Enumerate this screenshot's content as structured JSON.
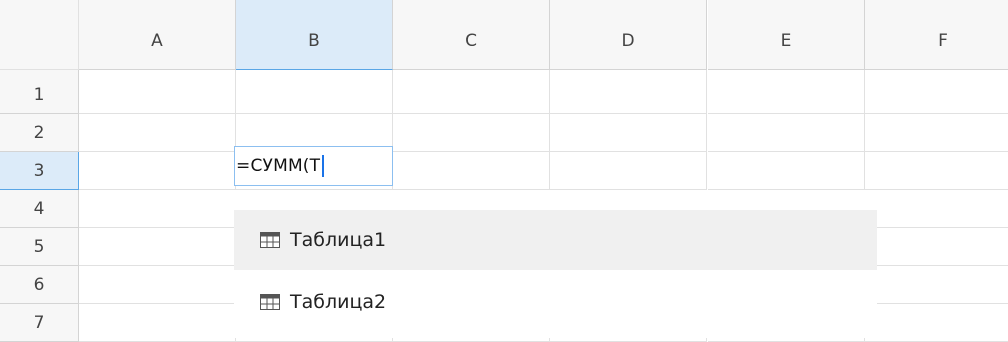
{
  "columns": [
    "A",
    "B",
    "C",
    "D",
    "E",
    "F"
  ],
  "rows": [
    "1",
    "2",
    "3",
    "4",
    "5",
    "6",
    "7"
  ],
  "selected_column": "B",
  "selected_row": "3",
  "editor": {
    "text": "=СУММ(Т"
  },
  "suggestions": [
    {
      "label": "Таблица1",
      "icon": "table-icon",
      "highlighted": true
    },
    {
      "label": "Таблица2",
      "icon": "table-icon",
      "highlighted": false
    }
  ],
  "colors": {
    "selection": "#dcebf9",
    "accent": "#1a73e8",
    "hover": "#f0f0f0"
  }
}
